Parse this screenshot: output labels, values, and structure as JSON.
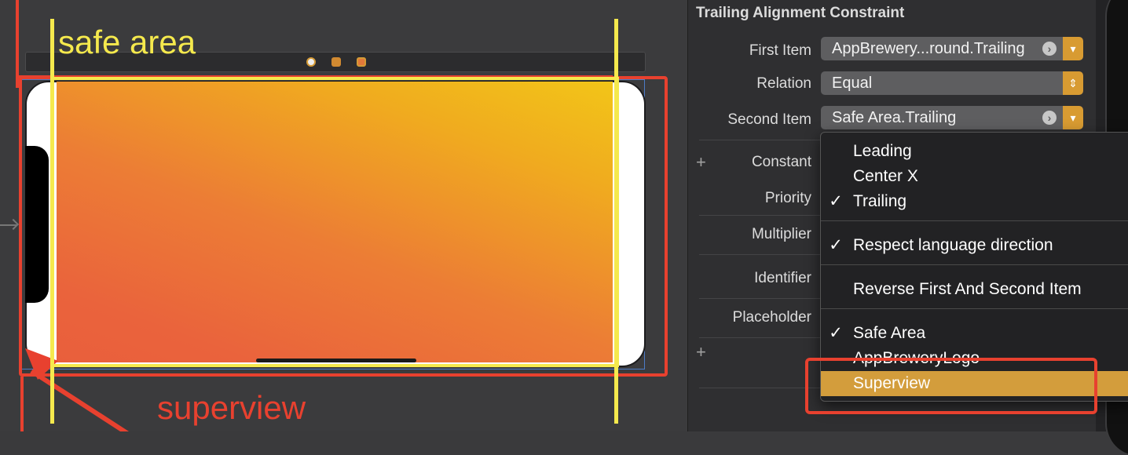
{
  "annotations": {
    "safe_area_label": "safe area",
    "superview_label": "superview"
  },
  "inspector": {
    "title": "Trailing Alignment Constraint",
    "first_item": {
      "label": "First Item",
      "value": "AppBrewery...round.Trailing"
    },
    "relation": {
      "label": "Relation",
      "value": "Equal"
    },
    "second_item": {
      "label": "Second Item",
      "value": "Safe Area.Trailing"
    },
    "constant": {
      "label": "Constant"
    },
    "priority": {
      "label": "Priority"
    },
    "multiplier": {
      "label": "Multiplier"
    },
    "identifier": {
      "label": "Identifier"
    },
    "placeholder": {
      "label": "Placeholder"
    },
    "add_symbol": "+"
  },
  "menu": {
    "items": [
      {
        "label": "Leading",
        "checked": false
      },
      {
        "label": "Center X",
        "checked": false
      },
      {
        "label": "Trailing",
        "checked": true
      },
      {
        "label": "Respect language direction",
        "checked": true
      },
      {
        "label": "Reverse First And Second Item",
        "checked": false
      },
      {
        "label": "Safe Area",
        "checked": true
      },
      {
        "label": "AppBreweryLogo",
        "checked": false
      },
      {
        "label": "Superview",
        "checked": false,
        "highlighted": true
      }
    ],
    "check_glyph": "✓"
  },
  "colors": {
    "accent": "#d89b32",
    "annotation_red": "#e8412f",
    "annotation_yellow": "#f5e94d",
    "gradient_top": "#f2c518",
    "gradient_bottom": "#e95f3c"
  }
}
